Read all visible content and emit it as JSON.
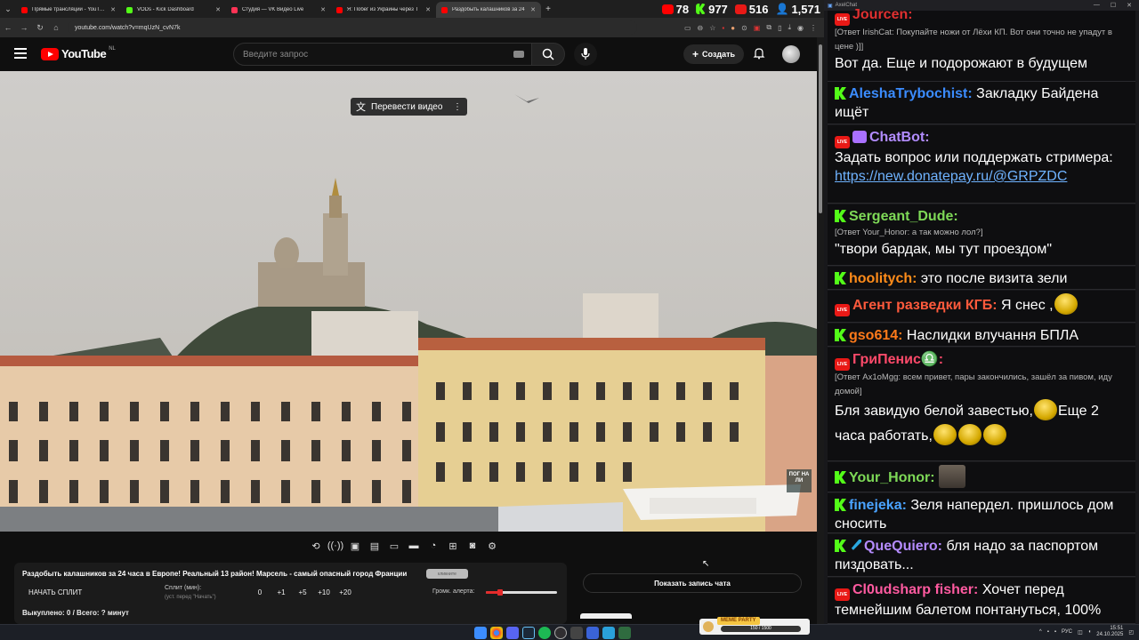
{
  "browser": {
    "tabs": [
      {
        "label": "Прямые трансляции - YouTube",
        "color": "#ff0000",
        "active": false
      },
      {
        "label": "VODs - Kick Dashboard",
        "color": "#53fc18",
        "active": false
      },
      {
        "label": "Студия — VK Видео Live",
        "color": "#ff3355",
        "active": false
      },
      {
        "label": "Я: Побег из Украины через Т",
        "color": "#ff0000",
        "active": false
      },
      {
        "label": "Раздобыть калашников за 24",
        "color": "#ff0000",
        "active": true
      }
    ],
    "url": "youtube.com/watch?v=mqUzN_cvN7k"
  },
  "stats": [
    {
      "platform": "youtube",
      "value": "78",
      "color": "#ff0000"
    },
    {
      "platform": "kick",
      "value": "977",
      "color": "#53fc18"
    },
    {
      "platform": "vk-live",
      "value": "516",
      "color": "#e91916"
    },
    {
      "platform": "total-viewers",
      "value": "1,571",
      "color": "#4aa3ff"
    }
  ],
  "youtube": {
    "logo_text": "YouTube",
    "region": "NL",
    "search_placeholder": "Введите запрос",
    "create_label": "Создать",
    "translate_label": "Перевести видео",
    "watermark": "ПОГ НА ЛИ",
    "title": "Раздобыть калашников за 24 часа в Европе! Реальный 13 район! Марсель - самый опасный город Франции",
    "badge": "кликните",
    "split_button": "НАЧАТЬ СПЛИТ",
    "split_label": "Сплит (мин):",
    "split_hint": "(уст. перед \"Начать\")",
    "split_values": [
      "0",
      "+1",
      "+5",
      "+10",
      "+20"
    ],
    "volume_label": "Громк. алерта:",
    "volume_fraction": 0.2,
    "footer": "Выкуплено: 0 / Всего: ? минут",
    "show_chat": "Показать запись чата"
  },
  "chat": {
    "window_title": "AxelChat",
    "messages": [
      {
        "id": "m1",
        "platform": "live",
        "user": "Jourcen:",
        "color": "#e03030",
        "reply": "[Ответ IrishCat: Покупайте ножи от Лёхи КП. Вот они точно не упадут в цене )]]",
        "text": "Вот да. Еще и подорожают в будущем"
      },
      {
        "id": "m2",
        "platform": "kick",
        "user": "AleshaTrybochist:",
        "color": "#3b8cff",
        "text": "Закладку Байдена ищёт"
      },
      {
        "id": "m3",
        "platform": "live",
        "user": "ChatBot:",
        "color": "#b28cff",
        "text": "Задать вопрос или поддержать стримера:",
        "link": "https://new.donatepay.ru/@GRPZDC"
      },
      {
        "id": "m4",
        "platform": "kick",
        "user": "Sergeant_Dude:",
        "color": "#7ed957",
        "reply": "[Ответ Your_Honor: а так можно лол?]",
        "text": "\"твори бардак, мы тут проездом\""
      },
      {
        "id": "m5",
        "platform": "kick",
        "user": "hoolitych:",
        "color": "#ff8c1a",
        "text": "это после визита зели"
      },
      {
        "id": "m6",
        "platform": "live",
        "user": "Агент разведки КГБ:",
        "color": "#ff5a3c",
        "text": "Я снес ,"
      },
      {
        "id": "m7",
        "platform": "kick",
        "user": "gso614:",
        "color": "#ff7a1a",
        "text": "Наслидки влучання БПЛА"
      },
      {
        "id": "m8",
        "platform": "live",
        "user": "ГриПенис♎:",
        "color": "#ff4a6a",
        "reply": "[Ответ Ax1oMgg: всем привет, пары закончились, зашёл за пивом, иду домой]",
        "text": "Бля завидую белой завестью,",
        "text2": "Еще 2 часа работать,"
      },
      {
        "id": "m9",
        "platform": "kick",
        "user": "Your_Honor:",
        "color": "#7ed957",
        "text": ""
      },
      {
        "id": "m10",
        "platform": "kick",
        "user": "finejeka:",
        "color": "#4aa3ff",
        "text": "Зеля напердел. пришлось дом сносить"
      },
      {
        "id": "m11",
        "platform": "kick",
        "user": "QueQuiero:",
        "color": "#b58cff",
        "text": "бля надо за паспортом пиздовать..."
      },
      {
        "id": "m12",
        "platform": "live",
        "user": "Cl0udsharp fisher:",
        "color": "#ff5aa0",
        "text": "Хочет перед темнейшим балетом понтануться, 100%"
      }
    ]
  },
  "widget": {
    "title": "MEME PARTY",
    "progress": "150 / 1500"
  },
  "taskbar": {
    "lang": "РУС",
    "time": "15:51",
    "date": "24.10.2025"
  }
}
